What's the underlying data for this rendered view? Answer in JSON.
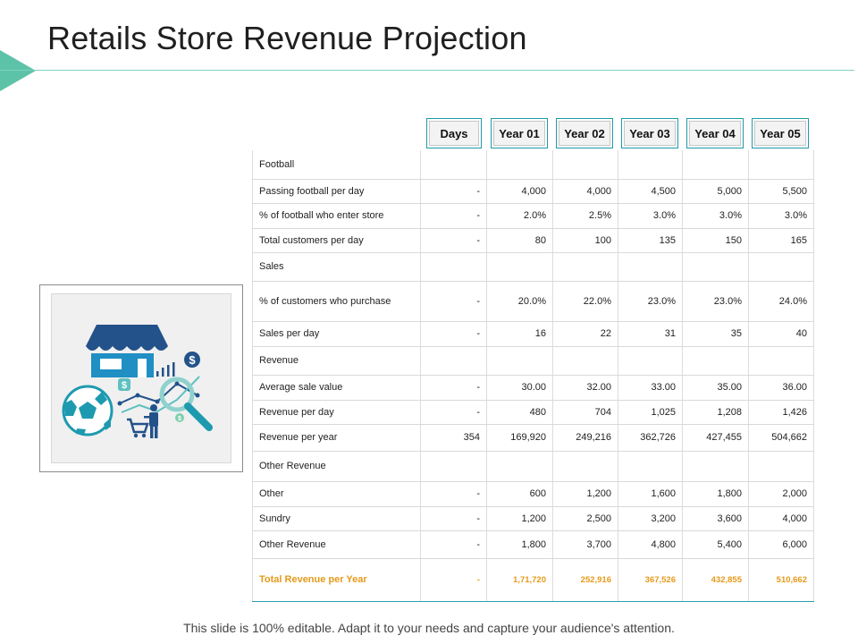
{
  "title": "Retails Store Revenue Projection",
  "columns": [
    "Days",
    "Year 01",
    "Year 02",
    "Year 03",
    "Year 04",
    "Year 05"
  ],
  "rows": [
    {
      "type": "section",
      "label": "Football",
      "cells": [
        "",
        "",
        "",
        "",
        "",
        ""
      ]
    },
    {
      "type": "data",
      "label": "Passing football per day",
      "cells": [
        "-",
        "4,000",
        "4,000",
        "4,500",
        "5,000",
        "5,500"
      ]
    },
    {
      "type": "data",
      "label": "% of football who enter store",
      "cells": [
        "-",
        "2.0%",
        "2.5%",
        "3.0%",
        "3.0%",
        "3.0%"
      ]
    },
    {
      "type": "data",
      "label": "Total customers per day",
      "cells": [
        "-",
        "80",
        "100",
        "135",
        "150",
        "165"
      ]
    },
    {
      "type": "section",
      "label": "Sales",
      "cells": [
        "",
        "",
        "",
        "",
        "",
        ""
      ]
    },
    {
      "type": "data",
      "label": "% of customers who purchase",
      "cells": [
        "-",
        "20.0%",
        "22.0%",
        "23.0%",
        "23.0%",
        "24.0%"
      ]
    },
    {
      "type": "data",
      "label": "Sales per day",
      "cells": [
        "-",
        "16",
        "22",
        "31",
        "35",
        "40"
      ]
    },
    {
      "type": "section",
      "label": "Revenue",
      "cells": [
        "",
        "",
        "",
        "",
        "",
        ""
      ]
    },
    {
      "type": "data",
      "label": "Average sale value",
      "cells": [
        "-",
        "30.00",
        "32.00",
        "33.00",
        "35.00",
        "36.00"
      ]
    },
    {
      "type": "data",
      "label": "Revenue per day",
      "cells": [
        "-",
        "480",
        "704",
        "1,025",
        "1,208",
        "1,426"
      ]
    },
    {
      "type": "data",
      "label": "Revenue per year",
      "cells": [
        "354",
        "169,920",
        "249,216",
        "362,726",
        "427,455",
        "504,662"
      ]
    },
    {
      "type": "section",
      "label": "Other Revenue",
      "cells": [
        "",
        "",
        "",
        "",
        "",
        ""
      ]
    },
    {
      "type": "data",
      "label": "Other",
      "cells": [
        "-",
        "600",
        "1,200",
        "1,600",
        "1,800",
        "2,000"
      ]
    },
    {
      "type": "data",
      "label": "Sundry",
      "cells": [
        "-",
        "1,200",
        "2,500",
        "3,200",
        "3,600",
        "4,000"
      ]
    },
    {
      "type": "data",
      "label": "Other Revenue",
      "cells": [
        "-",
        "1,800",
        "3,700",
        "4,800",
        "5,400",
        "6,000"
      ]
    },
    {
      "type": "total",
      "label": "Total Revenue per Year",
      "cells": [
        "-",
        "1,71,720",
        "252,916",
        "367,526",
        "432,855",
        "510,662"
      ]
    }
  ],
  "illustration": {
    "icons": [
      "store-icon",
      "soccer-ball-icon",
      "shopping-cart-icon",
      "magnifier-icon",
      "dollar-icon",
      "bar-chart-icon"
    ],
    "dollar_sign": "$"
  },
  "footer": "This slide is 100% editable. Adapt it to your needs and capture your audience's attention.",
  "colors": {
    "accent": "#1e9aa8",
    "total": "#e69a1a",
    "triangle": "#5dc3a8",
    "navy": "#23528a"
  }
}
